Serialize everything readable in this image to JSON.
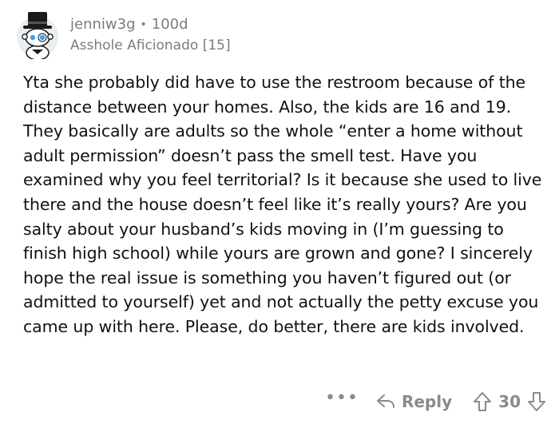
{
  "comment": {
    "username": "jenniw3g",
    "separator": "•",
    "age": "100d",
    "flair": "Asshole Aficionado [15]",
    "body": "Yta she probably did have to use the restroom because of the distance between your homes. Also, the kids are 16 and 19. They basically are adults so the whole “enter a home without adult permission” doesn’t pass the smell test. Have you examined why you feel territorial? Is it because she used to live there and the house doesn’t feel like it’s really yours? Are you salty about your husband’s kids moving in (I’m guessing to finish high school) while yours are grown and gone? I sincerely hope the real issue is something you haven’t figured out (or admitted to yourself) yet and not actually the petty excuse you came up with here. Please, do better, there are kids involved."
  },
  "actions": {
    "more_label": "•••",
    "reply_label": "Reply",
    "vote_count": "30"
  },
  "icons": {
    "avatar": "snoo-avatar-top-hat",
    "reply": "reply-arrow-icon",
    "upvote": "upvote-arrow-icon",
    "downvote": "downvote-arrow-icon"
  },
  "colors": {
    "meta_text": "#7c7c7c",
    "body_text": "#111111",
    "avatar_bg": "#e9eef1"
  }
}
